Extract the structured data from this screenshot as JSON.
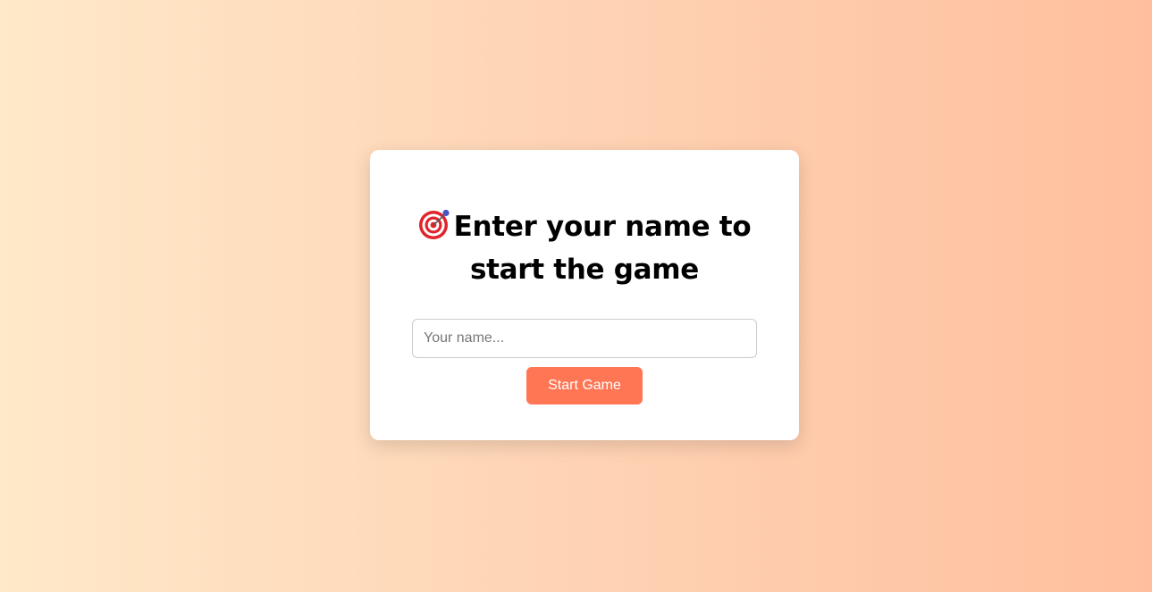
{
  "dialog": {
    "title": "Enter your name to start the game",
    "icon": "target-dart-icon"
  },
  "name_input": {
    "value": "",
    "placeholder": "Your name..."
  },
  "start_button": {
    "label": "Start Game"
  },
  "colors": {
    "background_start": "#ffe9c9",
    "background_end": "#ffbf9e",
    "card": "#ffffff",
    "button": "#ff7654",
    "button_text": "#ffffff",
    "title_text": "#000000"
  }
}
